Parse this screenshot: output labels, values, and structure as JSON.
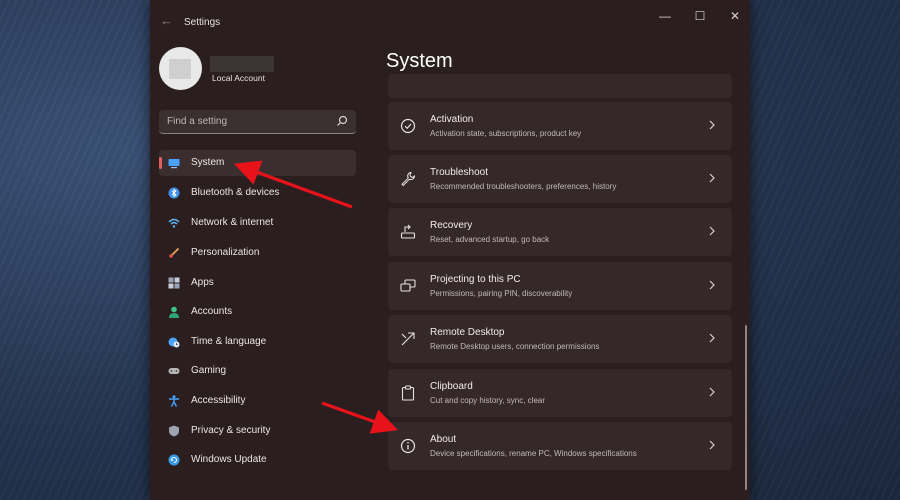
{
  "window": {
    "title": "Settings",
    "controls": {
      "minimize": "—",
      "maximize": "☐",
      "close": "✕"
    }
  },
  "account": {
    "type": "Local Account"
  },
  "search": {
    "placeholder": "Find a setting"
  },
  "sidebar": {
    "items": [
      {
        "label": "System",
        "icon": "monitor-icon",
        "color": "#4aa3ff",
        "selected": true
      },
      {
        "label": "Bluetooth & devices",
        "icon": "bluetooth-icon",
        "color": "#3f8fe8"
      },
      {
        "label": "Network & internet",
        "icon": "wifi-icon",
        "color": "#5fb7f5"
      },
      {
        "label": "Personalization",
        "icon": "brush-icon",
        "color": "#e9a35a"
      },
      {
        "label": "Apps",
        "icon": "apps-icon",
        "color": "#9aa4b8"
      },
      {
        "label": "Accounts",
        "icon": "person-icon",
        "color": "#3ec48b"
      },
      {
        "label": "Time & language",
        "icon": "globe-clock-icon",
        "color": "#4aa3ff"
      },
      {
        "label": "Gaming",
        "icon": "controller-icon",
        "color": "#b7b7b7"
      },
      {
        "label": "Accessibility",
        "icon": "accessibility-icon",
        "color": "#4aa3ff"
      },
      {
        "label": "Privacy & security",
        "icon": "shield-icon",
        "color": "#9ea4ad"
      },
      {
        "label": "Windows Update",
        "icon": "update-icon",
        "color": "#3a9be9"
      }
    ]
  },
  "main": {
    "title": "System",
    "cards": [
      {
        "title": "Activation",
        "subtitle": "Activation state, subscriptions, product key",
        "icon": "check-circle-icon"
      },
      {
        "title": "Troubleshoot",
        "subtitle": "Recommended troubleshooters, preferences, history",
        "icon": "wrench-icon"
      },
      {
        "title": "Recovery",
        "subtitle": "Reset, advanced startup, go back",
        "icon": "recovery-icon"
      },
      {
        "title": "Projecting to this PC",
        "subtitle": "Permissions, pairing PIN, discoverability",
        "icon": "projecting-icon"
      },
      {
        "title": "Remote Desktop",
        "subtitle": "Remote Desktop users, connection permissions",
        "icon": "remote-desktop-icon"
      },
      {
        "title": "Clipboard",
        "subtitle": "Cut and copy history, sync, clear",
        "icon": "clipboard-icon"
      },
      {
        "title": "About",
        "subtitle": "Device specifications, rename PC, Windows specifications",
        "icon": "info-icon"
      }
    ]
  },
  "annotations": {
    "arrow_color": "#e8121b"
  }
}
